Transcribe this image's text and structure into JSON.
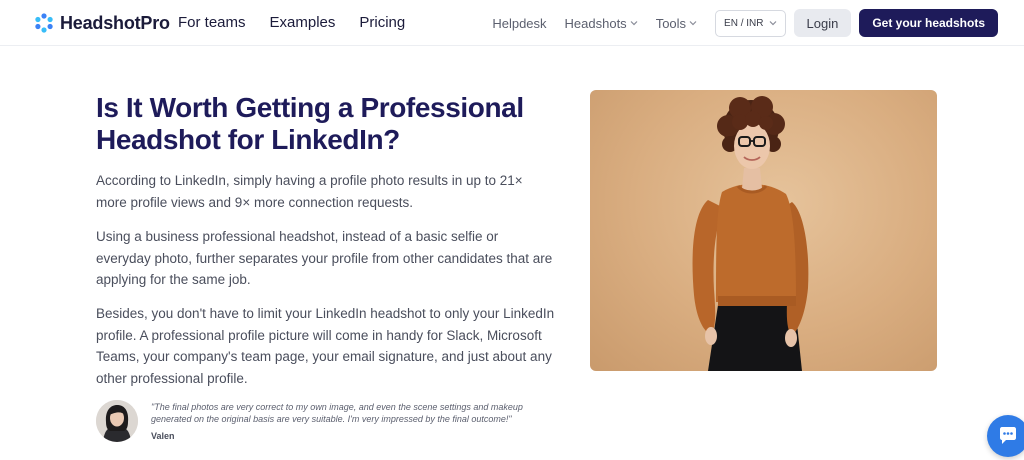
{
  "nav": {
    "brand": "HeadshotPro",
    "links": [
      "For teams",
      "Examples",
      "Pricing"
    ],
    "right_links": [
      {
        "label": "Helpdesk",
        "dropdown": false
      },
      {
        "label": "Headshots",
        "dropdown": true
      },
      {
        "label": "Tools",
        "dropdown": true
      }
    ],
    "language": "EN / INR",
    "login_label": "Login",
    "cta_label": "Get your headshots"
  },
  "main": {
    "headline": "Is It Worth Getting a Professional Headshot for LinkedIn?",
    "paragraphs": [
      "According to LinkedIn, simply having a profile photo results in up to 21× more profile views and 9× more connection requests.",
      "Using a business professional headshot, instead of a basic selfie or everyday photo, further separates your profile from other candidates that are applying for the same job.",
      "Besides, you don't have to limit your LinkedIn headshot to only your LinkedIn profile. A professional profile picture will come in handy for Slack, Microsoft Teams, your company's team page, your email signature, and just about any other professional profile."
    ]
  },
  "testimonial": {
    "quote": "\"The final photos are very correct to my own image, and even the scene settings and makeup generated on the original basis are very suitable. I'm very impressed by the final outcome!\"",
    "author": "Valen"
  },
  "icons": {
    "logo": "headshotpro-logo-icon",
    "chevron": "chevron-down-icon",
    "chat": "chat-bubble-icon"
  },
  "colors": {
    "brand_navy": "#1e1b5a",
    "text": "#4a4e5c",
    "chat_blue": "#2f7be6",
    "photo_background": "#d9ad80"
  }
}
